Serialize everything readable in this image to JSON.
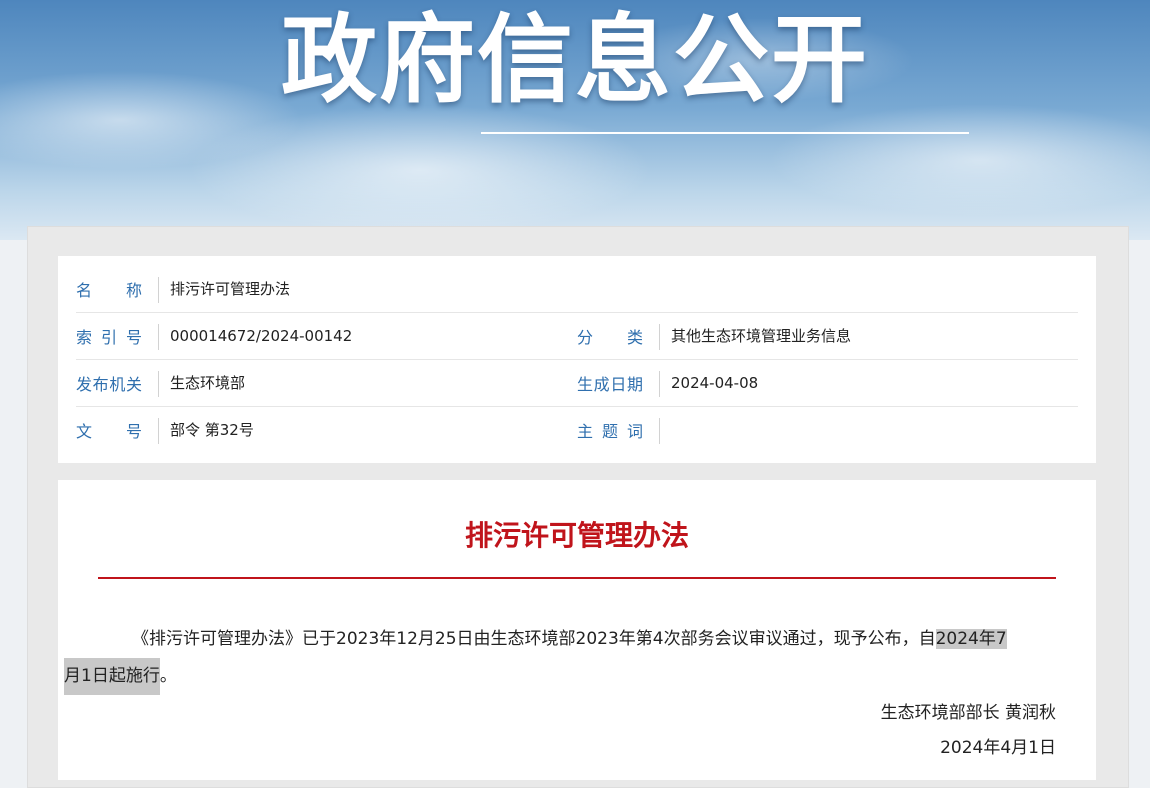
{
  "banner": {
    "title": "政府信息公开"
  },
  "meta": {
    "name_label": "名称",
    "name_value": "排污许可管理办法",
    "index_label": "索引号",
    "index_value": "000014672/2024-00142",
    "category_label": "分类",
    "category_value": "其他生态环境管理业务信息",
    "issuer_label": "发布机关",
    "issuer_value": "生态环境部",
    "date_label": "生成日期",
    "date_value": "2024-04-08",
    "doc_no_label": "文号",
    "doc_no_value": "部令 第32号",
    "subject_label": "主题词",
    "subject_value": ""
  },
  "article": {
    "title": "排污许可管理办法",
    "body_part1": "《排污许可管理办法》已于2023年12月25日由生态环境部2023年第4次部务会议审议通过，现予公布，自",
    "body_highlight1": "2024年7",
    "body_highlight2": "月1日起施行",
    "body_end": "。",
    "signer": "生态环境部部长 黄润秋",
    "sign_date": "2024年4月1日"
  },
  "colors": {
    "label_blue": "#2f6fae",
    "title_red": "#c0141b"
  }
}
